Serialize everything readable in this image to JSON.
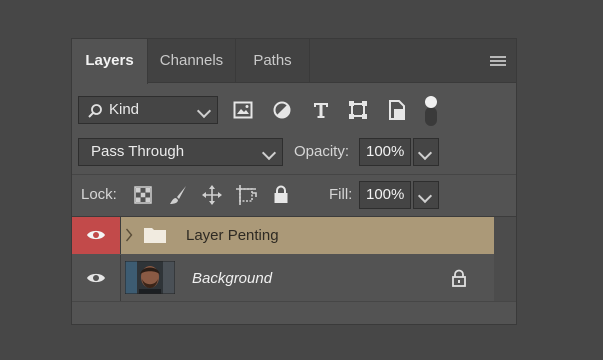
{
  "tabs": [
    {
      "label": "Layers",
      "active": true
    },
    {
      "label": "Channels",
      "active": false
    },
    {
      "label": "Paths",
      "active": false
    }
  ],
  "filter": {
    "kind_label": "Kind",
    "filter_icons": [
      "image-filter-icon",
      "adjustment-filter-icon",
      "type-filter-icon",
      "shape-filter-icon",
      "smart-object-filter-icon",
      "filter-toggle-icon"
    ]
  },
  "blend": {
    "mode": "Pass Through",
    "opacity_label": "Opacity:",
    "opacity_value": "100%"
  },
  "lock": {
    "label": "Lock:",
    "fill_label": "Fill:",
    "fill_value": "100%",
    "icons": [
      "lock-transparent-pixels-icon",
      "lock-image-pixels-icon",
      "lock-position-icon",
      "prevent-auto-nesting-icon",
      "lock-all-icon"
    ]
  },
  "layers": [
    {
      "name": "Layer Penting",
      "type": "group",
      "visible": true,
      "selected": true,
      "highlight_color": "#ab9978",
      "eye_bg": "#c24a4a"
    },
    {
      "name": "Background",
      "type": "image",
      "visible": true,
      "selected": false,
      "locked": true
    }
  ],
  "colors": {
    "panel_bg": "#535353",
    "tab_bar_bg": "#424242",
    "selected_layer": "#ab9978",
    "eye_highlight": "#c24a4a"
  }
}
